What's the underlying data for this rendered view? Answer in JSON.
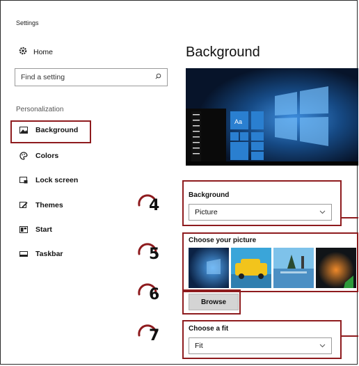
{
  "window": {
    "title": "Settings"
  },
  "sidebar": {
    "home_label": "Home",
    "search": {
      "placeholder": "Find a setting"
    },
    "section_label": "Personalization",
    "items": [
      {
        "label": "Background",
        "icon": "picture-icon",
        "active": true
      },
      {
        "label": "Colors",
        "icon": "palette-icon"
      },
      {
        "label": "Lock screen",
        "icon": "lock-screen-icon"
      },
      {
        "label": "Themes",
        "icon": "brush-icon"
      },
      {
        "label": "Start",
        "icon": "start-icon"
      },
      {
        "label": "Taskbar",
        "icon": "taskbar-icon"
      }
    ]
  },
  "main": {
    "title": "Background",
    "preview": {
      "tile_label": "Aa"
    },
    "background_field": {
      "label": "Background",
      "value": "Picture"
    },
    "picture_field": {
      "label": "Choose your picture"
    },
    "browse_label": "Browse",
    "fit_field": {
      "label": "Choose a fit",
      "value": "Fit"
    }
  },
  "annotations": {
    "steps": [
      "4",
      "5",
      "6",
      "7"
    ],
    "highlight_color": "#8e1b1e"
  },
  "colors": {
    "accent": "#0078d7",
    "preview_bg": "#0b1b33"
  }
}
